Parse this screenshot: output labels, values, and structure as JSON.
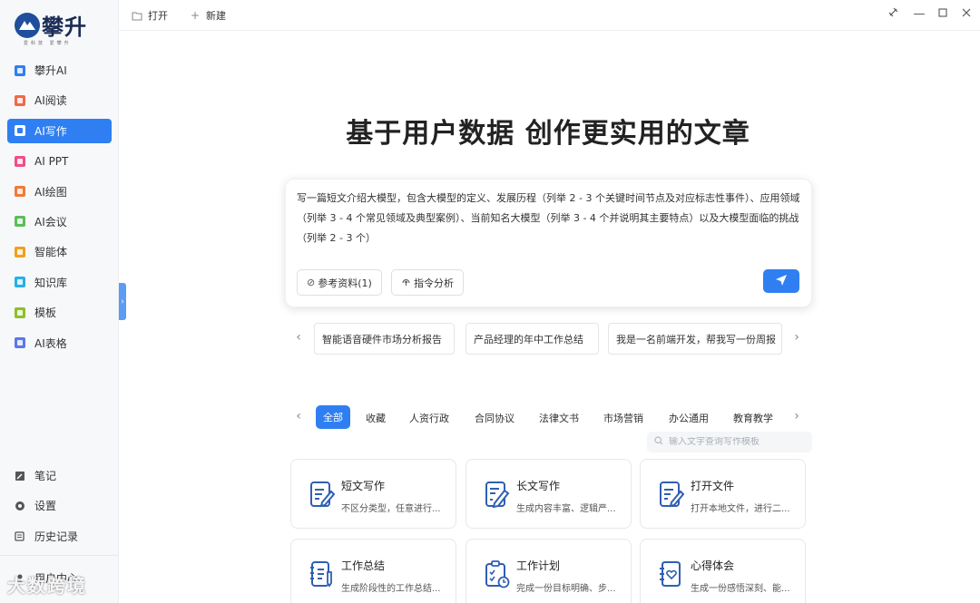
{
  "app": {
    "logo_text": "攀升",
    "logo_sub": "爱科技 爱攀升"
  },
  "sidebar": {
    "items": [
      {
        "label": "攀升AI",
        "color": "#2f7ff2",
        "active": false
      },
      {
        "label": "AI阅读",
        "color": "#f06a4a",
        "active": false
      },
      {
        "label": "AI写作",
        "color": "#2f7ff2",
        "active": true
      },
      {
        "label": "AI PPT",
        "color": "#ee4f86",
        "active": false
      },
      {
        "label": "AI绘图",
        "color": "#f07a3a",
        "active": false
      },
      {
        "label": "AI会议",
        "color": "#5bbd5a",
        "active": false
      },
      {
        "label": "智能体",
        "color": "#f0a020",
        "active": false
      },
      {
        "label": "知识库",
        "color": "#28b0e6",
        "active": false
      },
      {
        "label": "模板",
        "color": "#8fbf2a",
        "active": false
      },
      {
        "label": "AI表格",
        "color": "#5a78e8",
        "active": false
      }
    ],
    "bottom": [
      {
        "label": "笔记",
        "icon": "note-icon"
      },
      {
        "label": "设置",
        "icon": "gear-icon"
      },
      {
        "label": "历史记录",
        "icon": "history-icon"
      }
    ],
    "user": "用户中心"
  },
  "topbar": {
    "open_label": "打开",
    "new_label": "新建"
  },
  "main": {
    "title": "基于用户数据 创作更实用的文章",
    "prompt": "写一篇短文介绍大模型，包含大模型的定义、发展历程（列举 2 - 3 个关键时间节点及对应标志性事件）、应用领域（列举 3 - 4 个常见领域及典型案例）、当前知名大模型（列举 3 - 4 个并说明其主要特点）以及大模型面临的挑战（列举 2 - 3 个）",
    "ref_label": "参考资料(1)",
    "cmd_label": "指令分析",
    "suggestions": [
      "智能语音硬件市场分析报告",
      "产品经理的年中工作总结",
      "我是一名前端开发，帮我写一份周报"
    ],
    "categories": [
      "全部",
      "收藏",
      "人资行政",
      "合同协议",
      "法律文书",
      "市场营销",
      "办公通用",
      "教育教学"
    ],
    "search_placeholder": "输入文字查询写作模板",
    "cards": [
      {
        "title": "短文写作",
        "desc": "不区分类型，任意进行..."
      },
      {
        "title": "长文写作",
        "desc": "生成内容丰富、逻辑严..."
      },
      {
        "title": "打开文件",
        "desc": "打开本地文件，进行二..."
      },
      {
        "title": "工作总结",
        "desc": "生成阶段性的工作总结..."
      },
      {
        "title": "工作计划",
        "desc": "完成一份目标明确、步..."
      },
      {
        "title": "心得体会",
        "desc": "生成一份感悟深刻、能..."
      }
    ]
  },
  "watermark": "大数跨境",
  "colors": {
    "accent": "#2f7ff2"
  }
}
